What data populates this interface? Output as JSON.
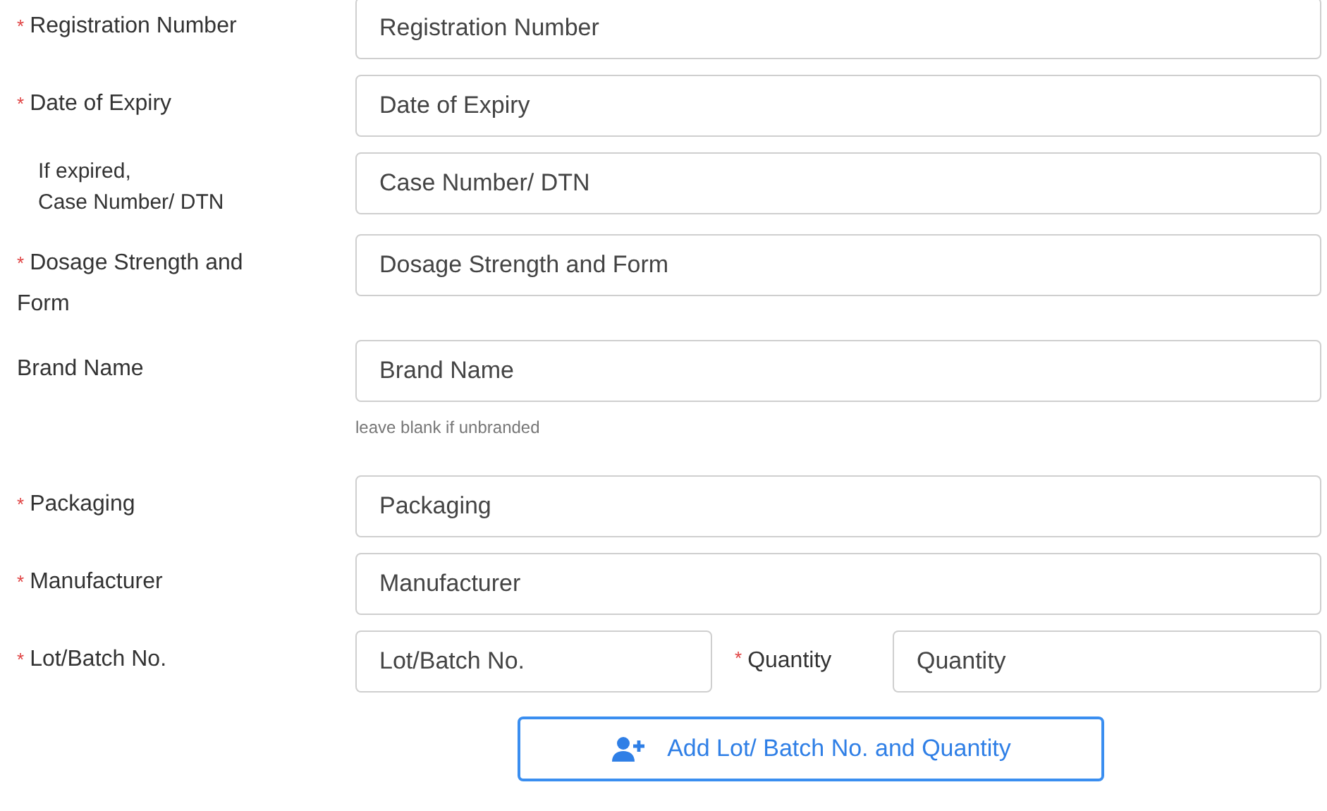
{
  "fields": [
    {
      "marker": "*",
      "label": "Registration Number",
      "kind": "field",
      "placeholder": "Registration Number"
    },
    {
      "marker": "*",
      "label": "Date of Expiry",
      "kind": "field",
      "placeholder": "Date of Expiry"
    },
    {
      "label": "If expired,\nCase Number/ DTN",
      "kind": "note",
      "placeholder": "Case Number/ DTN"
    },
    {
      "marker": "*",
      "label": "Dosage Strength and Form",
      "kind": "field",
      "placeholder": "Dosage Strength and Form"
    },
    {
      "label": "Brand Name",
      "kind": "field",
      "placeholder": "Brand Name",
      "hint": "leave blank if unbranded"
    },
    {
      "marker": "*",
      "label": "Packaging",
      "kind": "field",
      "placeholder": "Packaging"
    },
    {
      "marker": "*",
      "label": "Manufacturer",
      "kind": "field",
      "placeholder": "Manufacturer"
    },
    {
      "marker": "*",
      "label": "Lot/Batch No.",
      "kind": "pair",
      "placeholder": "Lot/Batch No.",
      "companion": {
        "marker": "*",
        "label": "Quantity",
        "placeholder": "Quantity"
      }
    }
  ],
  "add_button": {
    "label": "Add Lot/ Batch No. and Quantity"
  }
}
